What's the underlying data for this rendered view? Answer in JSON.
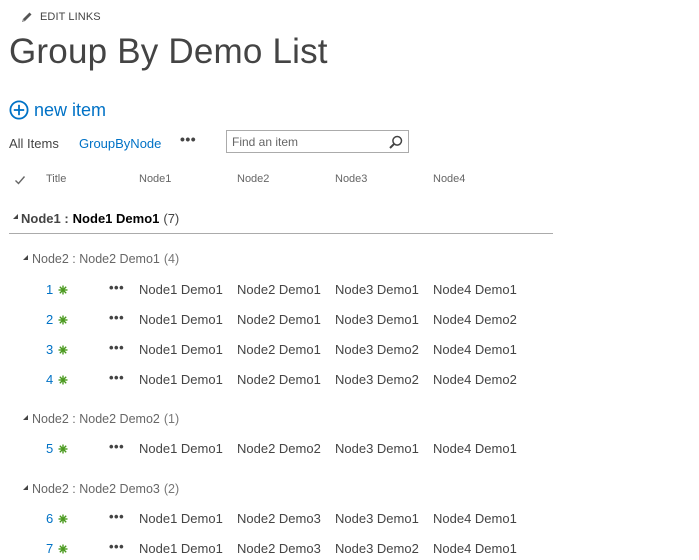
{
  "edit_links": {
    "label": "EDIT LINKS"
  },
  "page": {
    "title": "Group By Demo List"
  },
  "new_item": {
    "label": "new item"
  },
  "views": {
    "all_items": "All Items",
    "group_by_node": "GroupByNode",
    "more": "•••"
  },
  "search": {
    "placeholder": "Find an item"
  },
  "columns": {
    "title": "Title",
    "node1": "Node1",
    "node2": "Node2",
    "node3": "Node3",
    "node4": "Node4"
  },
  "group1": {
    "field": "Node1 :",
    "value": "Node1 Demo1",
    "count": "(7)"
  },
  "groups": [
    {
      "label": "Node2 : Node2 Demo1",
      "count": "(4)",
      "rows": [
        {
          "id": "1",
          "n1": "Node1 Demo1",
          "n2": "Node2 Demo1",
          "n3": "Node3 Demo1",
          "n4": "Node4 Demo1"
        },
        {
          "id": "2",
          "n1": "Node1 Demo1",
          "n2": "Node2 Demo1",
          "n3": "Node3 Demo1",
          "n4": "Node4 Demo2"
        },
        {
          "id": "3",
          "n1": "Node1 Demo1",
          "n2": "Node2 Demo1",
          "n3": "Node3 Demo2",
          "n4": "Node4 Demo1"
        },
        {
          "id": "4",
          "n1": "Node1 Demo1",
          "n2": "Node2 Demo1",
          "n3": "Node3 Demo2",
          "n4": "Node4 Demo2"
        }
      ]
    },
    {
      "label": "Node2 : Node2 Demo2",
      "count": "(1)",
      "rows": [
        {
          "id": "5",
          "n1": "Node1 Demo1",
          "n2": "Node2 Demo2",
          "n3": "Node3 Demo1",
          "n4": "Node4 Demo1"
        }
      ]
    },
    {
      "label": "Node2 : Node2 Demo3",
      "count": "(2)",
      "rows": [
        {
          "id": "6",
          "n1": "Node1 Demo1",
          "n2": "Node2 Demo3",
          "n3": "Node3 Demo1",
          "n4": "Node4 Demo1"
        },
        {
          "id": "7",
          "n1": "Node1 Demo1",
          "n2": "Node2 Demo3",
          "n3": "Node3 Demo2",
          "n4": "Node4 Demo1"
        }
      ]
    }
  ],
  "row_ellipsis": "•••",
  "colors": {
    "link_blue": "#0072c6",
    "new_badge_green": "#4a9a1e",
    "text": "#444444"
  }
}
